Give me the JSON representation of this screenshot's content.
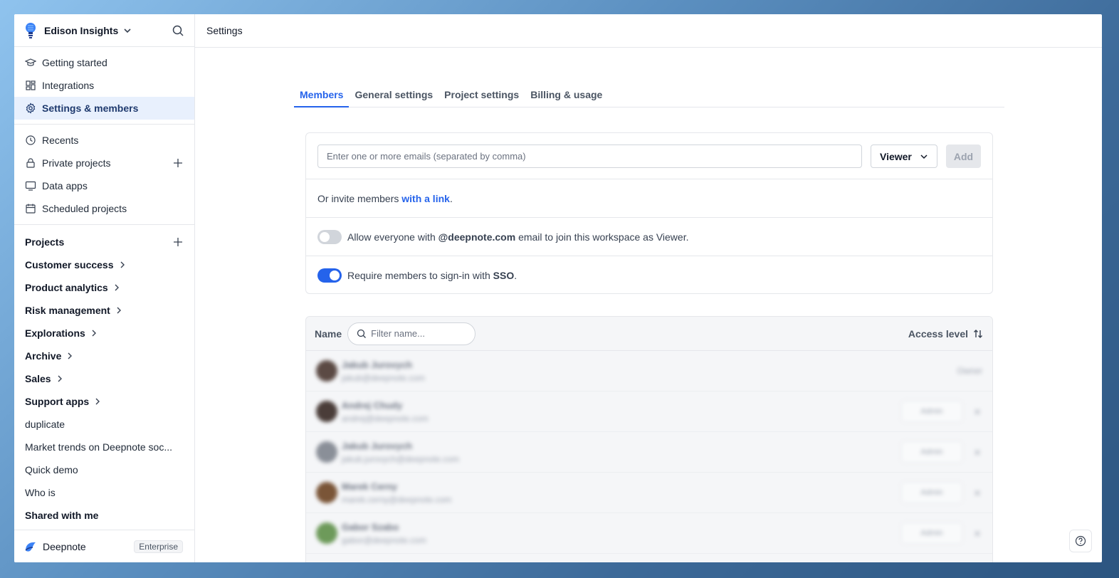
{
  "workspace": {
    "name": "Edison Insights"
  },
  "topbar": {
    "title": "Settings"
  },
  "sidebar": {
    "primary": [
      {
        "label": "Getting started",
        "icon": "graduation-cap-icon"
      },
      {
        "label": "Integrations",
        "icon": "integrations-icon"
      },
      {
        "label": "Settings & members",
        "icon": "gear-icon",
        "active": true
      }
    ],
    "secondary": [
      {
        "label": "Recents",
        "icon": "clock-icon"
      },
      {
        "label": "Private projects",
        "icon": "lock-icon"
      },
      {
        "label": "Data apps",
        "icon": "monitor-icon"
      },
      {
        "label": "Scheduled projects",
        "icon": "calendar-icon"
      }
    ],
    "projects_header": "Projects",
    "folders": [
      "Customer success",
      "Product analytics",
      "Risk management",
      "Explorations",
      "Archive",
      "Sales",
      "Support apps"
    ],
    "projects": [
      "duplicate",
      "Market trends on Deepnote soc...",
      "Quick demo",
      "Who is"
    ],
    "shared_header": "Shared with me",
    "footer": {
      "brand": "Deepnote",
      "plan": "Enterprise"
    }
  },
  "tabs": [
    "Members",
    "General settings",
    "Project settings",
    "Billing & usage"
  ],
  "invite": {
    "email_placeholder": "Enter one or more emails (separated by comma)",
    "role": "Viewer",
    "add_label": "Add",
    "link_prefix": "Or invite members ",
    "link_text": "with a link",
    "link_suffix": ".",
    "domain_toggle": {
      "prefix": "Allow everyone with ",
      "domain": "@deepnote.com",
      "suffix": " email to join this workspace as Viewer.",
      "enabled": false
    },
    "sso_toggle": {
      "prefix": "Require members to sign-in with ",
      "strong": "SSO",
      "suffix": ".",
      "enabled": true
    }
  },
  "members": {
    "name_header": "Name",
    "filter_placeholder": "Filter name...",
    "access_header": "Access level",
    "rows": [
      {
        "name": "Jakub Jurovych",
        "email": "jakub@deepnote.com",
        "role": "Owner",
        "avatar_color": "#5b4a44"
      },
      {
        "name": "Andrej Chudy",
        "email": "andrej@deepnote.com",
        "role": "Admin",
        "avatar_color": "#4a3d39"
      },
      {
        "name": "Jakub Jurovych",
        "email": "jakub.jurovych@deepnote.com",
        "role": "Admin",
        "avatar_color": "#8a8f98"
      },
      {
        "name": "Marek Cerny",
        "email": "marek.cerny@deepnote.com",
        "role": "Admin",
        "avatar_color": "#7a5537"
      },
      {
        "name": "Gabor Szabo",
        "email": "gabor@deepnote.com",
        "role": "Admin",
        "avatar_color": "#6d9a5a"
      }
    ]
  }
}
